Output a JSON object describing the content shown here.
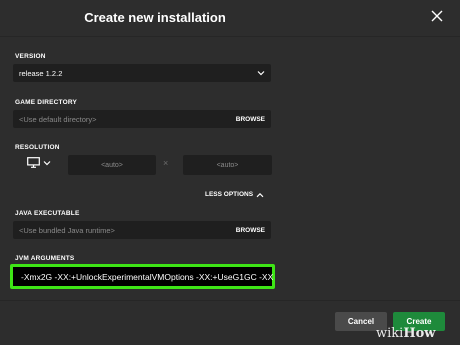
{
  "dialog": {
    "title": "Create new installation"
  },
  "version": {
    "label": "VERSION",
    "value": "release 1.2.2"
  },
  "game_directory": {
    "label": "GAME DIRECTORY",
    "placeholder": "<Use default directory>",
    "browse_label": "BROWSE"
  },
  "resolution": {
    "label": "RESOLUTION",
    "width_placeholder": "<auto>",
    "height_placeholder": "<auto>",
    "separator": "×"
  },
  "options_toggle": {
    "label": "LESS OPTIONS"
  },
  "java_executable": {
    "label": "JAVA EXECUTABLE",
    "placeholder": "<Use bundled Java runtime>",
    "browse_label": "BROWSE"
  },
  "jvm_arguments": {
    "label": "JVM ARGUMENTS",
    "value": "-Xmx2G -XX:+UnlockExperimentalVMOptions -XX:+UseG1GC -XX",
    "highlight_color": "#3ee516"
  },
  "footer": {
    "cancel_label": "Cancel",
    "create_label": "Create"
  },
  "watermark": {
    "part1": "wiki",
    "part2": "How"
  },
  "colors": {
    "background": "#2d2d2d",
    "field": "#1f1f1f",
    "create_button": "#1e8a3b",
    "cancel_button": "#4a4a4a"
  },
  "icons": {
    "close": "close-icon",
    "dropdown": "chevron-down-icon",
    "monitor": "monitor-icon",
    "collapse": "chevron-up-icon"
  }
}
